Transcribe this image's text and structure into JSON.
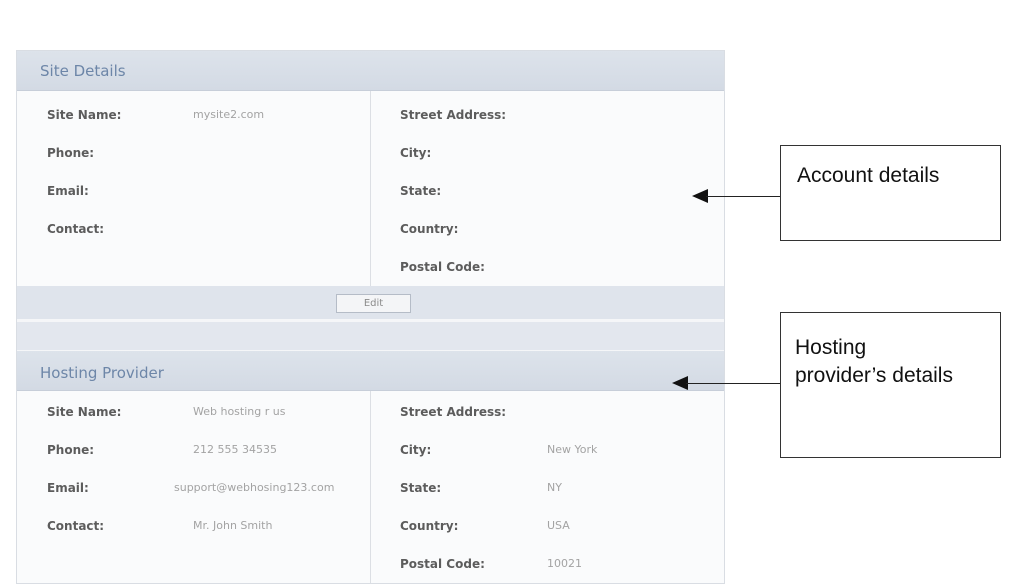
{
  "site_details": {
    "title": "Site Details",
    "left": [
      {
        "label": "Site Name:",
        "value": "mysite2.com"
      },
      {
        "label": "Phone:",
        "value": ""
      },
      {
        "label": "Email:",
        "value": ""
      },
      {
        "label": "Contact:",
        "value": ""
      }
    ],
    "right": [
      {
        "label": "Street Address:",
        "value": ""
      },
      {
        "label": "City:",
        "value": ""
      },
      {
        "label": "State:",
        "value": ""
      },
      {
        "label": "Country:",
        "value": ""
      },
      {
        "label": "Postal Code:",
        "value": ""
      }
    ],
    "edit_label": "Edit"
  },
  "hosting_provider": {
    "title": "Hosting Provider",
    "left": [
      {
        "label": "Site Name:",
        "value": "Web hosting r us"
      },
      {
        "label": "Phone:",
        "value": "212 555 34535"
      },
      {
        "label": "Email:",
        "value": "support@webhosing123.com"
      },
      {
        "label": "Contact:",
        "value": "Mr. John Smith"
      }
    ],
    "right": [
      {
        "label": "Street Address:",
        "value": ""
      },
      {
        "label": "City:",
        "value": "New York"
      },
      {
        "label": "State:",
        "value": "NY"
      },
      {
        "label": "Country:",
        "value": "USA"
      },
      {
        "label": "Postal Code:",
        "value": "10021"
      }
    ]
  },
  "callouts": {
    "account": "Account details",
    "hosting_line1": "Hosting",
    "hosting_line2": "provider’s details"
  },
  "colors": {
    "header_bg": "#d3dae4",
    "title_text": "#6d86a8",
    "label_text": "#5c5c5c",
    "value_text": "#a3a3a3"
  }
}
